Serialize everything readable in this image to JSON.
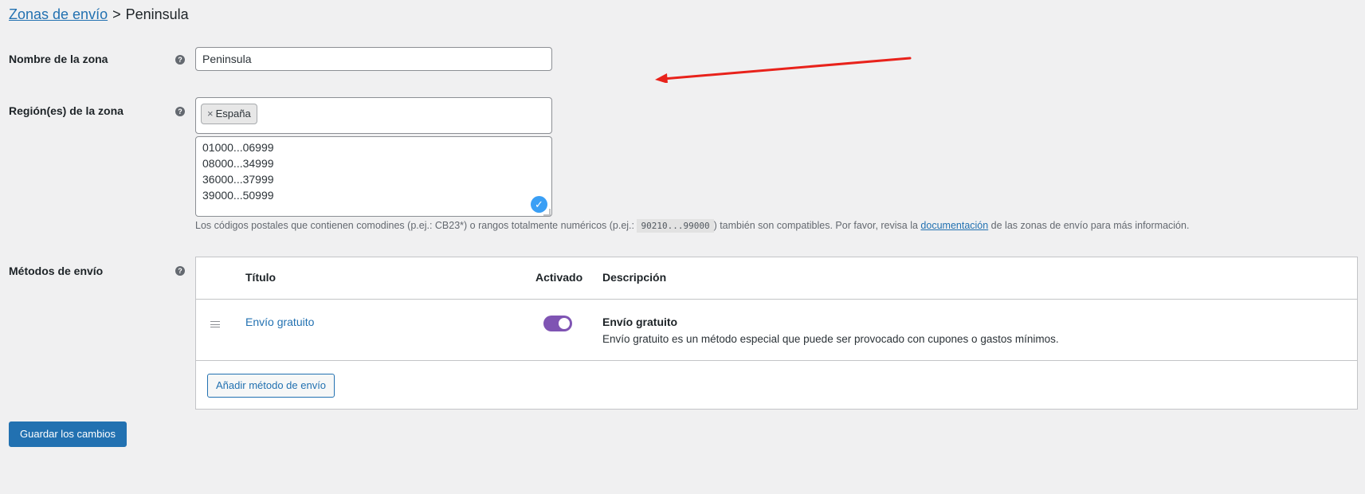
{
  "breadcrumb": {
    "parent": "Zonas de envío",
    "separator": ">",
    "current": "Peninsula"
  },
  "zone_name": {
    "label": "Nombre de la zona",
    "value": "Peninsula"
  },
  "zone_regions": {
    "label": "Región(es) de la zona",
    "chip_remove": "×",
    "chip_label": "España",
    "postcodes": "01000...06999\n08000...34999\n36000...37999\n39000...50999",
    "help_text_before": "Los códigos postales que contienen comodines (p.ej.: CB23*) o rangos totalmente numéricos (p.ej.: ",
    "help_code": "90210...99000",
    "help_text_middle": ") también son compatibles. Por favor, revisa la ",
    "help_link": "documentación",
    "help_text_after": " de las zonas de envío para más información."
  },
  "shipping_methods": {
    "label": "Métodos de envío",
    "columns": {
      "title": "Título",
      "enabled": "Activado",
      "description": "Descripción"
    },
    "rows": [
      {
        "title": "Envío gratuito",
        "enabled": true,
        "desc_title": "Envío gratuito",
        "desc_text": "Envío gratuito es un método especial que puede ser provocado con cupones o gastos mínimos."
      }
    ],
    "add_button": "Añadir método de envío"
  },
  "save_button": "Guardar los cambios",
  "colors": {
    "link": "#2271b1",
    "toggle_on": "#7f54b3",
    "annotation_arrow": "#e8221b"
  },
  "icons": {
    "help": "help-circle-icon",
    "drag": "drag-handle-icon",
    "validated": "check-circle-icon"
  }
}
